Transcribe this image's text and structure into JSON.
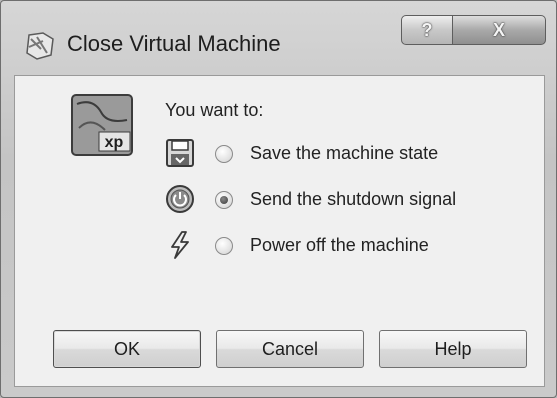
{
  "window": {
    "title": "Close Virtual Machine",
    "caption_help": "?",
    "caption_close": "X"
  },
  "dialog": {
    "prompt": "You want to:",
    "os_badge": "xp",
    "options": [
      {
        "label": "Save the machine state",
        "icon": "floppy-save-icon",
        "selected": false
      },
      {
        "label": "Send the shutdown signal",
        "icon": "power-button-icon",
        "selected": true
      },
      {
        "label": "Power off the machine",
        "icon": "lightning-icon",
        "selected": false
      }
    ]
  },
  "buttons": {
    "ok": "OK",
    "cancel": "Cancel",
    "help": "Help"
  }
}
